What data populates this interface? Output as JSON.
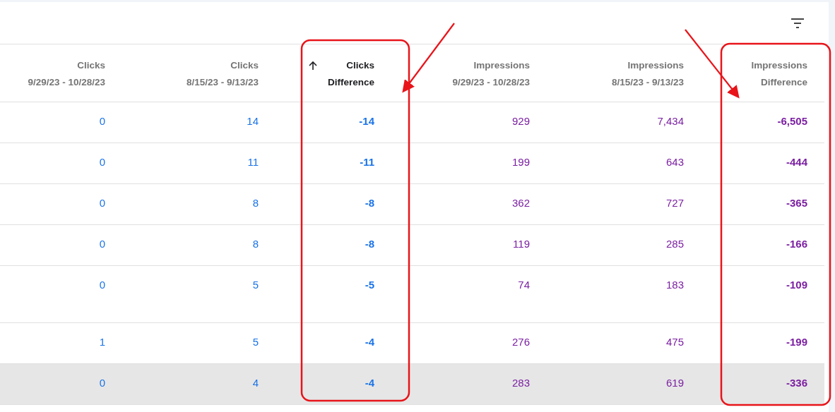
{
  "toolbar": {
    "filter_button": true
  },
  "table": {
    "columns": [
      {
        "title": "Clicks",
        "subtitle": "9/29/23 - 10/28/23",
        "kind": "clicks",
        "sorted": false,
        "bold_values": false,
        "highlighted": false
      },
      {
        "title": "Clicks",
        "subtitle": "8/15/23 - 9/13/23",
        "kind": "clicks",
        "sorted": false,
        "bold_values": false,
        "highlighted": false
      },
      {
        "title": "Clicks",
        "subtitle": "Difference",
        "kind": "clicks",
        "sorted": true,
        "bold_values": true,
        "highlighted": true
      },
      {
        "title": "Impressions",
        "subtitle": "9/29/23 - 10/28/23",
        "kind": "impressions",
        "sorted": false,
        "bold_values": false,
        "highlighted": false
      },
      {
        "title": "Impressions",
        "subtitle": "8/15/23 - 9/13/23",
        "kind": "impressions",
        "sorted": false,
        "bold_values": false,
        "highlighted": false
      },
      {
        "title": "Impressions",
        "subtitle": "Difference",
        "kind": "impressions",
        "sorted": false,
        "bold_values": true,
        "highlighted": true
      }
    ],
    "rows": [
      {
        "cells": [
          "0",
          "14",
          "-14",
          "929",
          "7,434",
          "-6,505"
        ],
        "highlighted": false
      },
      {
        "cells": [
          "0",
          "11",
          "-11",
          "199",
          "643",
          "-444"
        ],
        "highlighted": false
      },
      {
        "cells": [
          "0",
          "8",
          "-8",
          "362",
          "727",
          "-365"
        ],
        "highlighted": false
      },
      {
        "cells": [
          "0",
          "8",
          "-8",
          "119",
          "285",
          "-166"
        ],
        "highlighted": false
      },
      {
        "cells": [
          "0",
          "5",
          "-5",
          "74",
          "183",
          "-109"
        ],
        "highlighted": false
      },
      {
        "cells": [
          "1",
          "5",
          "-4",
          "276",
          "475",
          "-199"
        ],
        "highlighted": false
      },
      {
        "cells": [
          "0",
          "4",
          "-4",
          "283",
          "619",
          "-336"
        ],
        "highlighted": true
      }
    ]
  }
}
